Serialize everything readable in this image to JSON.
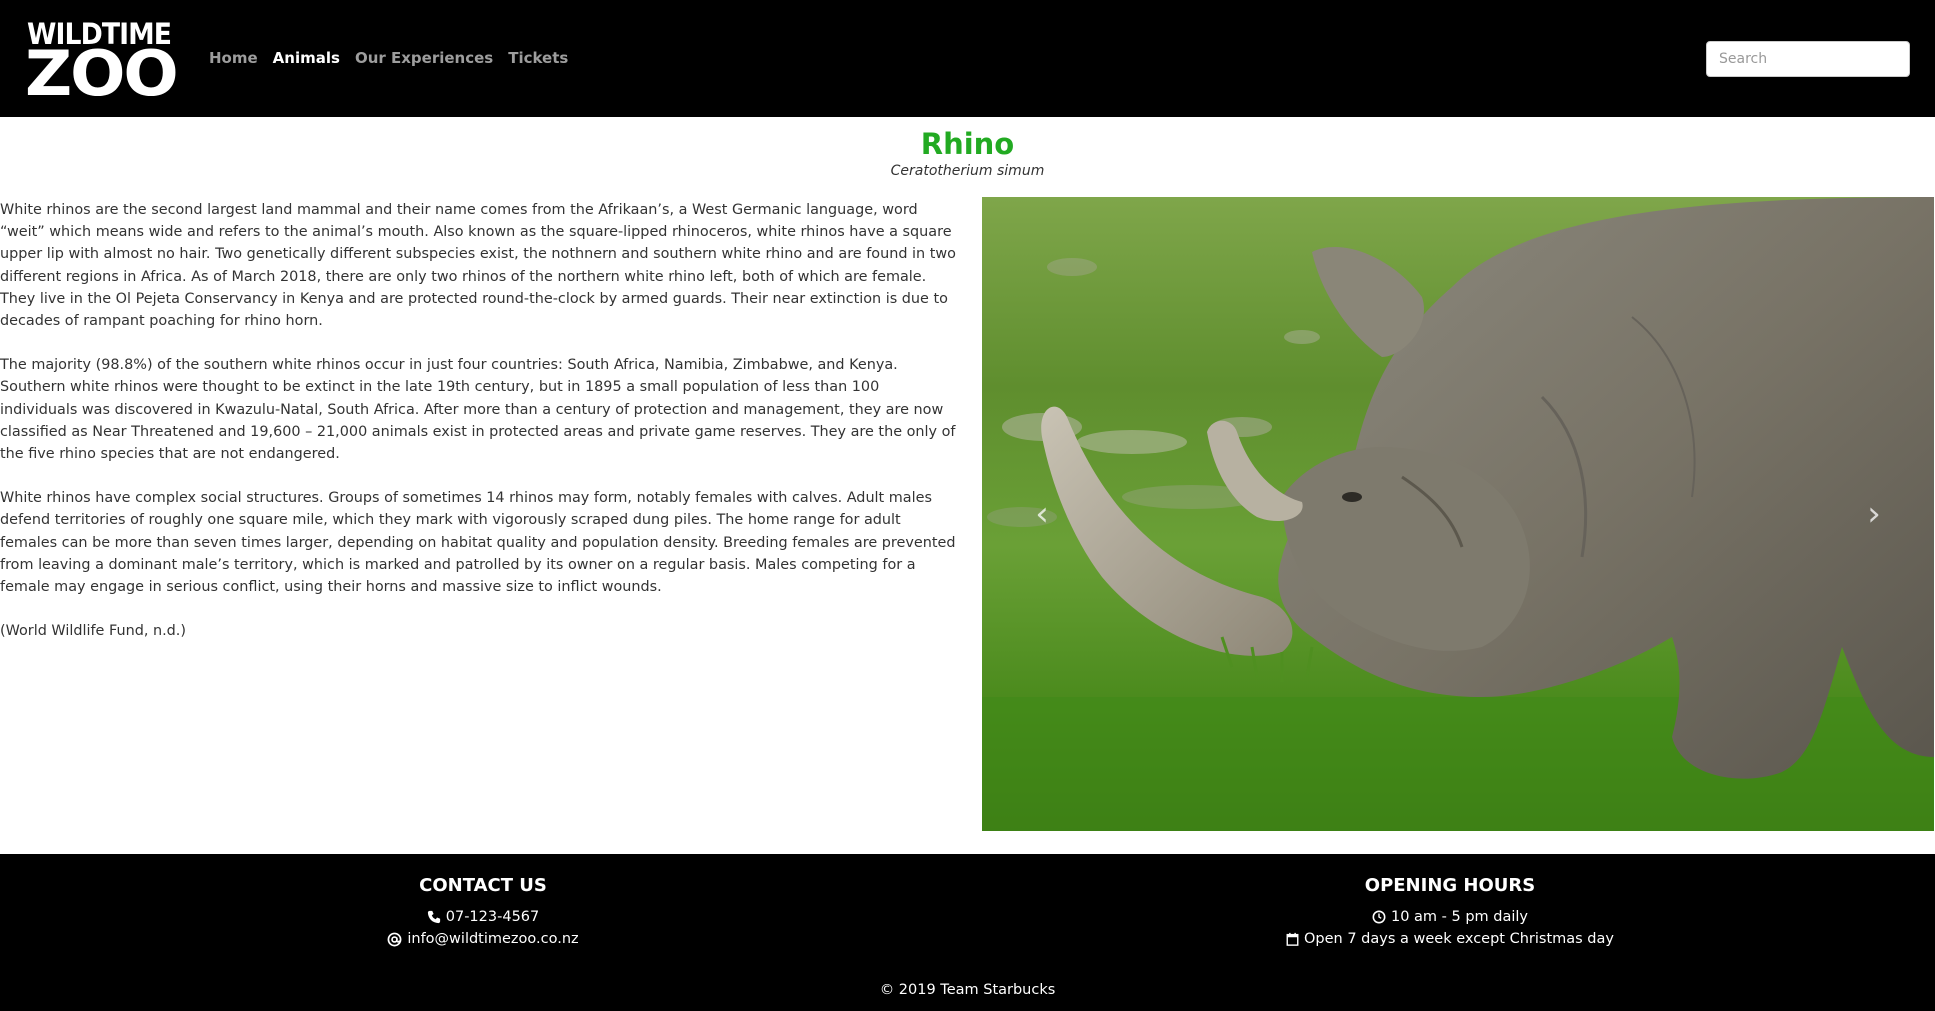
{
  "brand": {
    "logo_top": "WILDTIME",
    "logo_bottom": "ZOO"
  },
  "nav": {
    "items": [
      {
        "label": "Home",
        "active": false
      },
      {
        "label": "Animals",
        "active": true
      },
      {
        "label": "Our Experiences",
        "active": false
      },
      {
        "label": "Tickets",
        "active": false
      }
    ],
    "search_placeholder": "Search"
  },
  "animal": {
    "name": "Rhino",
    "scientific_name": "Ceratotherium simum",
    "paragraphs": [
      "White rhinos are the second largest land mammal and their name comes from the Afrikaan’s, a West Germanic language, word “weit” which means wide and refers to the animal’s mouth. Also known as the square-lipped rhinoceros, white rhinos have a square upper lip with almost no hair. Two genetically different subspecies exist, the nothnern and southern white rhino and are found in two different regions in Africa. As of March 2018, there are only two rhinos of the northern white rhino left, both of which are female. They live in the Ol Pejeta Conservancy in Kenya and are protected round-the-clock by armed guards. Their near extinction is due to decades of rampant poaching for rhino horn.",
      "The majority (98.8%) of the southern white rhinos occur in just four countries: South Africa, Namibia, Zimbabwe, and Kenya. Southern white rhinos were thought to be extinct in the late 19th century, but in 1895 a small population of less than 100 individuals was discovered in Kwazulu-Natal, South Africa. After more than a century of protection and management, they are now classified as Near Threatened and 19,600 – 21,000 animals exist in protected areas and private game reserves. They are the only of the five rhino species that are not endangered.",
      "White rhinos have complex social structures. Groups of sometimes 14 rhinos may form, notably females with calves. Adult males defend territories of roughly one square mile, which they mark with vigorously scraped dung piles. The home range for adult females can be more than seven times larger, depending on habitat quality and population density. Breeding females are prevented from leaving a dominant male’s territory, which is marked and patrolled by its owner on a regular basis. Males competing for a female may engage in serious conflict, using their horns and massive size to inflict wounds.",
      "(World Wildlife Fund, n.d.)"
    ]
  },
  "carousel": {
    "prev_icon": "chevron-left-icon",
    "next_icon": "chevron-right-icon"
  },
  "footer": {
    "contact_heading": "CONTACT US",
    "phone": "07-123-4567",
    "email": "info@wildtimezoo.co.nz",
    "hours_heading": "OPENING HOURS",
    "hours": "10 am - 5 pm daily",
    "days": "Open 7 days a week except Christmas day",
    "copyright": "© 2019 Team Starbucks"
  },
  "colors": {
    "navbar_bg": "#000000",
    "title_green": "#22aa22",
    "nav_inactive": "#9d9d9d",
    "nav_active": "#ffffff"
  }
}
